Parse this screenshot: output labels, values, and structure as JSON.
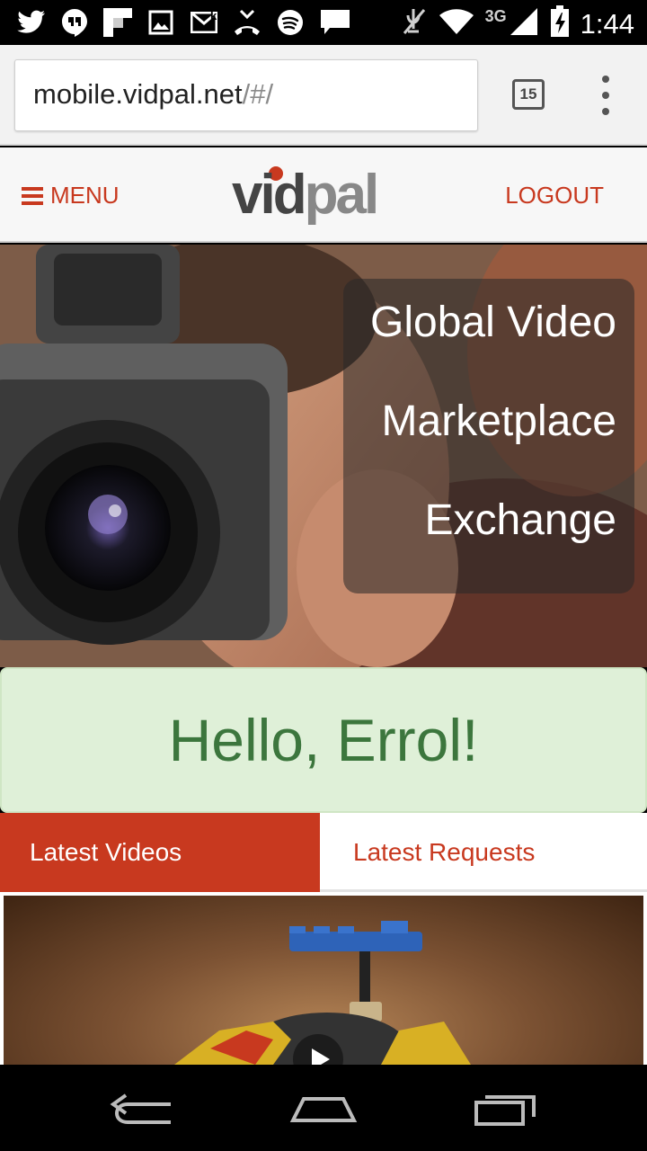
{
  "status_bar": {
    "notification_icons": [
      "twitter-icon",
      "hangouts-icon",
      "flipboard-icon",
      "image-icon",
      "gmail-icon",
      "missed-call-icon",
      "spotify-icon",
      "kik-icon"
    ],
    "kik_label": "kik·",
    "network_type": "3G",
    "time": "1:44"
  },
  "browser": {
    "url_host": "mobile.vidpal.net",
    "url_path": "/#/",
    "tab_count": "15"
  },
  "site_header": {
    "menu_label": "MENU",
    "logo_text": "vidpal",
    "logout_label": "LOGOUT",
    "accent_color": "#c8391f"
  },
  "hero": {
    "tagline": [
      "Global Video",
      "Marketplace",
      "Exchange"
    ]
  },
  "greeting": {
    "text": "Hello, Errol!"
  },
  "tabs": {
    "active": "Latest Videos",
    "items": [
      {
        "label": "Latest Videos"
      },
      {
        "label": "Latest Requests"
      }
    ]
  },
  "nav_bar": {
    "buttons": [
      "back-icon",
      "home-icon",
      "recents-icon"
    ]
  }
}
